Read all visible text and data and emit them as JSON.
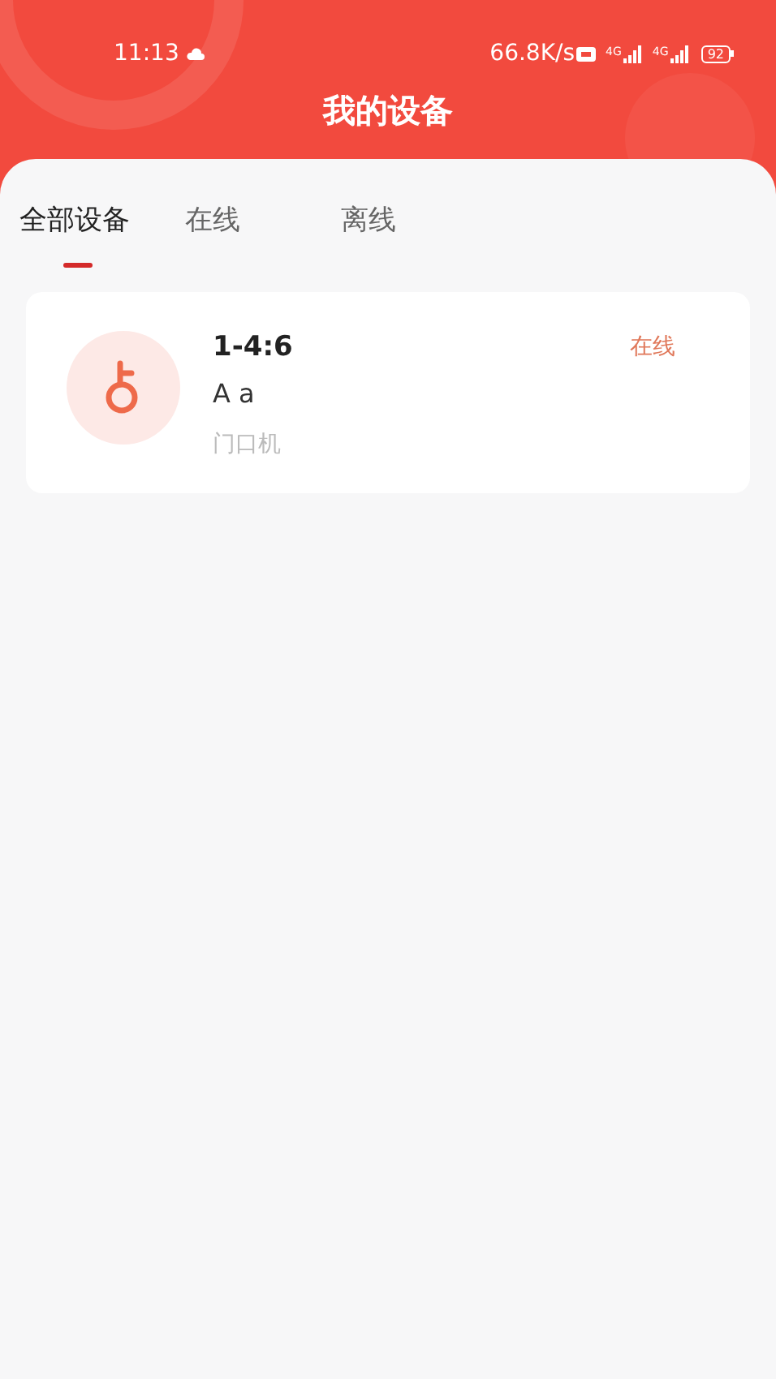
{
  "status_bar": {
    "time": "11:13",
    "speed": "66.8K/s",
    "signals": [
      "4G",
      "4G"
    ],
    "battery": "92"
  },
  "title": "我的设备",
  "tabs": [
    {
      "label": "全部设备",
      "selected": true
    },
    {
      "label": "在线",
      "selected": false
    },
    {
      "label": "离线",
      "selected": false
    }
  ],
  "devices": [
    {
      "name": "1-4:6",
      "subtitle": "A a",
      "type": "门口机",
      "status": "在线",
      "online": true
    }
  ]
}
